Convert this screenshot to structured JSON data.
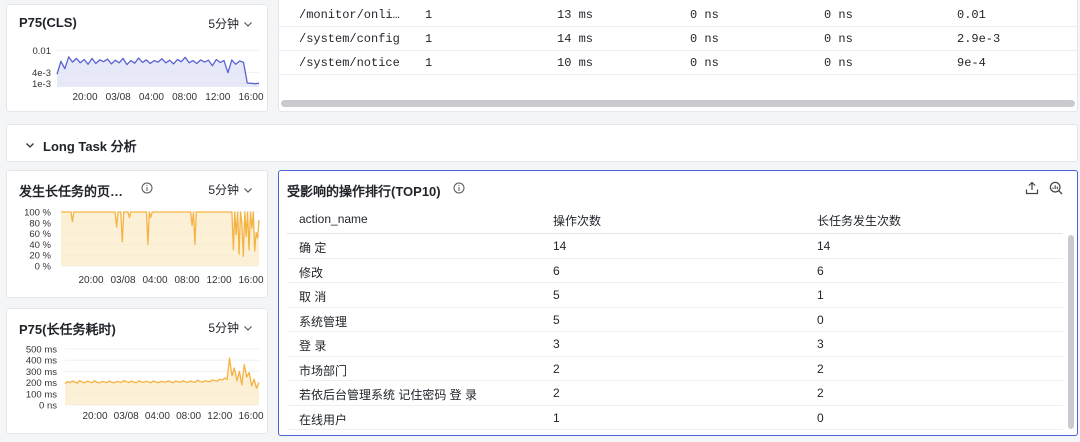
{
  "cls_panel": {
    "title": "P75(CLS)",
    "period": "5分钟",
    "y_ticks": [
      "0.01",
      "4e-3",
      "1e-3"
    ],
    "x_ticks": [
      "20:00",
      "03/08",
      "04:00",
      "08:00",
      "12:00",
      "16:00"
    ]
  },
  "top_table": {
    "rows": [
      [
        "/monitor/onli…",
        "1",
        "13 ms",
        "0 ns",
        "0 ns",
        "0.01"
      ],
      [
        "/system/config",
        "1",
        "14 ms",
        "0 ns",
        "0 ns",
        "2.9e-3"
      ],
      [
        "/system/notice",
        "1",
        "10 ms",
        "0 ns",
        "0 ns",
        "9e-4"
      ]
    ]
  },
  "section": {
    "title": "Long Task 分析"
  },
  "longtask_panel": {
    "title": "发生长任务的页…",
    "period": "5分钟",
    "y_ticks": [
      "100 %",
      "80 %",
      "60 %",
      "40 %",
      "20 %",
      "0 %"
    ],
    "x_ticks": [
      "20:00",
      "03/08",
      "04:00",
      "08:00",
      "12:00",
      "16:00"
    ]
  },
  "p75_longtask_panel": {
    "title": "P75(长任务耗时)",
    "period": "5分钟",
    "y_ticks": [
      "500 ms",
      "400 ms",
      "300 ms",
      "200 ms",
      "100 ms",
      "0 ns"
    ],
    "x_ticks": [
      "20:00",
      "03/08",
      "04:00",
      "08:00",
      "12:00",
      "16:00"
    ]
  },
  "ranking": {
    "title": "受影响的操作排行(TOP10)",
    "columns": [
      "action_name",
      "操作次数",
      "长任务发生次数"
    ],
    "rows": [
      [
        "确  定",
        "14",
        "14"
      ],
      [
        "修改",
        "6",
        "6"
      ],
      [
        "取  消",
        "5",
        "1"
      ],
      [
        "系统管理",
        "5",
        "0"
      ],
      [
        "登  录",
        "3",
        "3"
      ],
      [
        "市场部门",
        "2",
        "2"
      ],
      [
        "若依后台管理系统  记住密码  登  录",
        "2",
        "2"
      ],
      [
        "在线用户",
        "1",
        "0"
      ]
    ]
  },
  "colors": {
    "cls_line": "#5b63d3",
    "cls_fill": "#dfe2f6",
    "longtask_line": "#f5b342",
    "longtask_fill": "#fbebc9",
    "selected_border": "#4a63d6"
  },
  "chart_data": [
    {
      "type": "area",
      "title": "P75(CLS)",
      "x_ticks": [
        "20:00",
        "03/08",
        "04:00",
        "08:00",
        "12:00",
        "16:00"
      ],
      "y_ticks": [
        "0.01",
        "4e-3",
        "1e-3"
      ],
      "ylim": [
        0,
        0.012
      ],
      "series": [
        {
          "values": [
            0.0035,
            0.007,
            0.005,
            0.0082,
            0.0068,
            0.0078,
            0.0066,
            0.0075,
            0.0062,
            0.0078,
            0.0064,
            0.0074,
            0.0069,
            0.0076,
            0.0063,
            0.0073,
            0.0066,
            0.0078,
            0.0061,
            0.0072,
            0.0065,
            0.0079,
            0.0067,
            0.0074,
            0.0064,
            0.0072,
            0.0068,
            0.0077,
            0.0066,
            0.0073,
            0.0063,
            0.0075,
            0.0069,
            0.0081,
            0.0066,
            0.0072,
            0.0064,
            0.0074,
            0.0068,
            0.0073,
            0.0058,
            0.0075,
            0.0067,
            0.0072,
            0.0039,
            0.0074,
            0.0062,
            0.0071,
            0.0067,
            0.0011,
            0.001,
            0.0009,
            0.001
          ]
        }
      ]
    },
    {
      "type": "area",
      "title": "发生长任务的页…",
      "x_ticks": [
        "20:00",
        "03/08",
        "04:00",
        "08:00",
        "12:00",
        "16:00"
      ],
      "y_ticks": [
        "100 %",
        "80 %",
        "60 %",
        "40 %",
        "20 %",
        "0 %"
      ],
      "ylim": [
        0,
        100
      ],
      "series": [
        {
          "values": [
            100,
            100,
            100,
            100,
            100,
            100,
            100,
            100,
            82,
            100,
            100,
            100,
            100,
            100,
            100,
            100,
            100,
            100,
            100,
            100,
            100,
            100,
            100,
            100,
            100,
            100,
            100,
            100,
            100,
            100,
            100,
            100,
            100,
            100,
            100,
            100,
            100,
            100,
            100,
            72,
            100,
            100,
            100,
            45,
            100,
            100,
            100,
            100,
            90,
            100,
            100,
            100,
            100,
            100,
            100,
            100,
            100,
            100,
            100,
            100,
            100,
            40,
            100,
            90,
            100,
            100,
            100,
            100,
            100,
            100,
            100,
            100,
            100,
            100,
            100,
            100,
            100,
            100,
            100,
            100,
            100,
            100,
            100,
            100,
            100,
            100,
            100,
            100,
            100,
            100,
            100,
            100,
            75,
            100,
            40,
            100,
            100,
            100,
            100,
            100,
            100,
            100,
            100,
            100,
            100,
            100,
            100,
            100,
            100,
            100,
            100,
            100,
            100,
            100,
            100,
            100,
            100,
            100,
            100,
            100,
            100,
            30,
            100,
            58,
            100,
            22,
            100,
            80,
            18,
            100,
            55,
            100,
            30,
            100,
            70,
            100,
            28,
            62,
            52,
            85
          ]
        }
      ]
    },
    {
      "type": "area",
      "title": "P75(长任务耗时)",
      "x_ticks": [
        "20:00",
        "03/08",
        "04:00",
        "08:00",
        "12:00",
        "16:00"
      ],
      "y_ticks": [
        "500 ms",
        "400 ms",
        "300 ms",
        "200 ms",
        "100 ms",
        "0 ns"
      ],
      "ylim": [
        0,
        500
      ],
      "series": [
        {
          "values": [
            190,
            210,
            200,
            215,
            205,
            195,
            220,
            205,
            198,
            212,
            206,
            200,
            218,
            203,
            196,
            210,
            207,
            199,
            215,
            204,
            197,
            211,
            206,
            201,
            219,
            208,
            200,
            213,
            205,
            198,
            216,
            207,
            202,
            212,
            206,
            199,
            214,
            205,
            200,
            211,
            208,
            203,
            215,
            206,
            199,
            213,
            209,
            202,
            217,
            208,
            201,
            214,
            207,
            203,
            221,
            210,
            205,
            216,
            212,
            208,
            225,
            218,
            214,
            230,
            222,
            240,
            228,
            420,
            260,
            330,
            215,
            300,
            180,
            360,
            250,
            290,
            170,
            230,
            150,
            200
          ]
        }
      ]
    }
  ]
}
